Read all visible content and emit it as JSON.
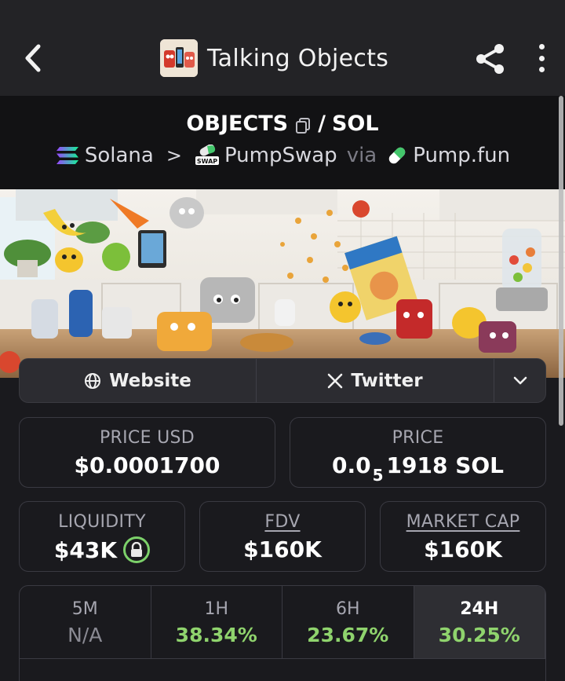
{
  "header": {
    "title": "Talking Objects",
    "back_icon": "chevron-left-icon",
    "share_icon": "share-icon",
    "more_icon": "more-vertical-icon"
  },
  "pair": {
    "base": "OBJECTS",
    "slash": "/",
    "quote": "SOL",
    "chain": "Solana",
    "chevron": ">",
    "dex": "PumpSwap",
    "dex_badge": "SWAP",
    "via": "via",
    "launchpad": "Pump.fun"
  },
  "links": {
    "website": "Website",
    "twitter": "Twitter"
  },
  "stats": {
    "price_usd_label": "PRICE USD",
    "price_usd_value": "$0.0001700",
    "price_label": "PRICE",
    "price_prefix": "0.0",
    "price_subscript": "5",
    "price_suffix": "1918 SOL",
    "liquidity_label": "LIQUIDITY",
    "liquidity_value": "$43K",
    "fdv_label": "FDV",
    "fdv_value": "$160K",
    "mcap_label": "MARKET CAP",
    "mcap_value": "$160K"
  },
  "timeframes": [
    {
      "label": "5M",
      "value": "N/A"
    },
    {
      "label": "1H",
      "value": "38.34%"
    },
    {
      "label": "6H",
      "value": "23.67%"
    },
    {
      "label": "24H",
      "value": "30.25%"
    }
  ],
  "colors": {
    "accent_green": "#8fd36d",
    "background": "#1a1a1e",
    "header_bg": "#232326"
  }
}
